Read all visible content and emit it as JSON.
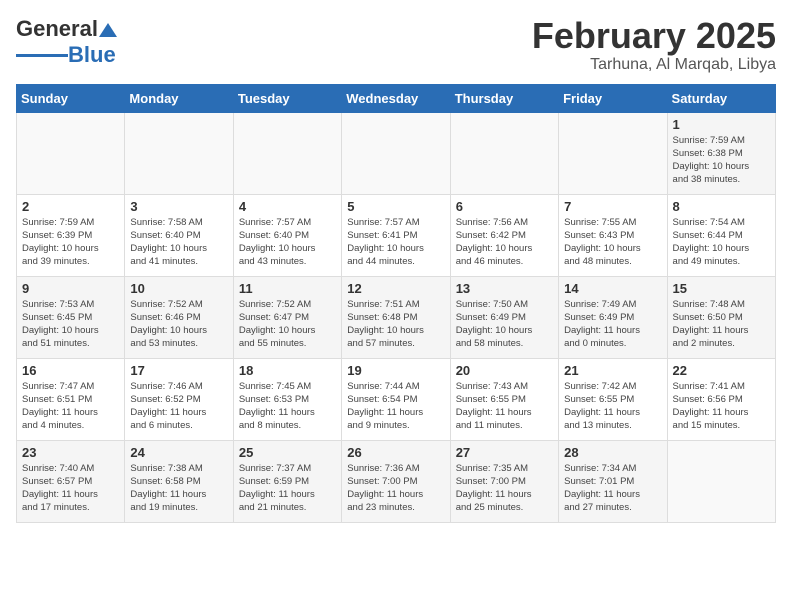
{
  "header": {
    "logo_general": "General",
    "logo_blue": "Blue",
    "month_title": "February 2025",
    "location": "Tarhuna, Al Marqab, Libya"
  },
  "weekdays": [
    "Sunday",
    "Monday",
    "Tuesday",
    "Wednesday",
    "Thursday",
    "Friday",
    "Saturday"
  ],
  "weeks": [
    {
      "days": [
        {
          "num": "",
          "info": ""
        },
        {
          "num": "",
          "info": ""
        },
        {
          "num": "",
          "info": ""
        },
        {
          "num": "",
          "info": ""
        },
        {
          "num": "",
          "info": ""
        },
        {
          "num": "",
          "info": ""
        },
        {
          "num": "1",
          "info": "Sunrise: 7:59 AM\nSunset: 6:38 PM\nDaylight: 10 hours\nand 38 minutes."
        }
      ]
    },
    {
      "days": [
        {
          "num": "2",
          "info": "Sunrise: 7:59 AM\nSunset: 6:39 PM\nDaylight: 10 hours\nand 39 minutes."
        },
        {
          "num": "3",
          "info": "Sunrise: 7:58 AM\nSunset: 6:40 PM\nDaylight: 10 hours\nand 41 minutes."
        },
        {
          "num": "4",
          "info": "Sunrise: 7:57 AM\nSunset: 6:40 PM\nDaylight: 10 hours\nand 43 minutes."
        },
        {
          "num": "5",
          "info": "Sunrise: 7:57 AM\nSunset: 6:41 PM\nDaylight: 10 hours\nand 44 minutes."
        },
        {
          "num": "6",
          "info": "Sunrise: 7:56 AM\nSunset: 6:42 PM\nDaylight: 10 hours\nand 46 minutes."
        },
        {
          "num": "7",
          "info": "Sunrise: 7:55 AM\nSunset: 6:43 PM\nDaylight: 10 hours\nand 48 minutes."
        },
        {
          "num": "8",
          "info": "Sunrise: 7:54 AM\nSunset: 6:44 PM\nDaylight: 10 hours\nand 49 minutes."
        }
      ]
    },
    {
      "days": [
        {
          "num": "9",
          "info": "Sunrise: 7:53 AM\nSunset: 6:45 PM\nDaylight: 10 hours\nand 51 minutes."
        },
        {
          "num": "10",
          "info": "Sunrise: 7:52 AM\nSunset: 6:46 PM\nDaylight: 10 hours\nand 53 minutes."
        },
        {
          "num": "11",
          "info": "Sunrise: 7:52 AM\nSunset: 6:47 PM\nDaylight: 10 hours\nand 55 minutes."
        },
        {
          "num": "12",
          "info": "Sunrise: 7:51 AM\nSunset: 6:48 PM\nDaylight: 10 hours\nand 57 minutes."
        },
        {
          "num": "13",
          "info": "Sunrise: 7:50 AM\nSunset: 6:49 PM\nDaylight: 10 hours\nand 58 minutes."
        },
        {
          "num": "14",
          "info": "Sunrise: 7:49 AM\nSunset: 6:49 PM\nDaylight: 11 hours\nand 0 minutes."
        },
        {
          "num": "15",
          "info": "Sunrise: 7:48 AM\nSunset: 6:50 PM\nDaylight: 11 hours\nand 2 minutes."
        }
      ]
    },
    {
      "days": [
        {
          "num": "16",
          "info": "Sunrise: 7:47 AM\nSunset: 6:51 PM\nDaylight: 11 hours\nand 4 minutes."
        },
        {
          "num": "17",
          "info": "Sunrise: 7:46 AM\nSunset: 6:52 PM\nDaylight: 11 hours\nand 6 minutes."
        },
        {
          "num": "18",
          "info": "Sunrise: 7:45 AM\nSunset: 6:53 PM\nDaylight: 11 hours\nand 8 minutes."
        },
        {
          "num": "19",
          "info": "Sunrise: 7:44 AM\nSunset: 6:54 PM\nDaylight: 11 hours\nand 9 minutes."
        },
        {
          "num": "20",
          "info": "Sunrise: 7:43 AM\nSunset: 6:55 PM\nDaylight: 11 hours\nand 11 minutes."
        },
        {
          "num": "21",
          "info": "Sunrise: 7:42 AM\nSunset: 6:55 PM\nDaylight: 11 hours\nand 13 minutes."
        },
        {
          "num": "22",
          "info": "Sunrise: 7:41 AM\nSunset: 6:56 PM\nDaylight: 11 hours\nand 15 minutes."
        }
      ]
    },
    {
      "days": [
        {
          "num": "23",
          "info": "Sunrise: 7:40 AM\nSunset: 6:57 PM\nDaylight: 11 hours\nand 17 minutes."
        },
        {
          "num": "24",
          "info": "Sunrise: 7:38 AM\nSunset: 6:58 PM\nDaylight: 11 hours\nand 19 minutes."
        },
        {
          "num": "25",
          "info": "Sunrise: 7:37 AM\nSunset: 6:59 PM\nDaylight: 11 hours\nand 21 minutes."
        },
        {
          "num": "26",
          "info": "Sunrise: 7:36 AM\nSunset: 7:00 PM\nDaylight: 11 hours\nand 23 minutes."
        },
        {
          "num": "27",
          "info": "Sunrise: 7:35 AM\nSunset: 7:00 PM\nDaylight: 11 hours\nand 25 minutes."
        },
        {
          "num": "28",
          "info": "Sunrise: 7:34 AM\nSunset: 7:01 PM\nDaylight: 11 hours\nand 27 minutes."
        },
        {
          "num": "",
          "info": ""
        }
      ]
    }
  ]
}
